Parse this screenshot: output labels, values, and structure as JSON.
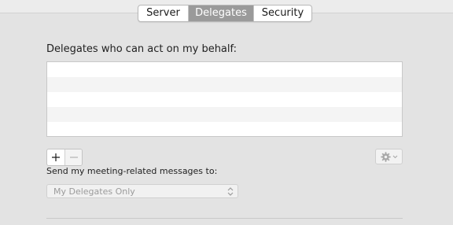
{
  "tabs": [
    {
      "label": "Server",
      "selected": false
    },
    {
      "label": "Delegates",
      "selected": true
    },
    {
      "label": "Security",
      "selected": false
    }
  ],
  "delegates": {
    "label": "Delegates who can act on my behalf:",
    "rows": []
  },
  "list_controls": {
    "add_icon": "plus-icon",
    "remove_icon": "minus-icon",
    "remove_enabled": false,
    "action_icon": "gear-icon",
    "action_menu_icon": "chevron-down-icon",
    "action_enabled": false
  },
  "messages": {
    "label": "Send my meeting-related messages to:",
    "selected": "My Delegates Only",
    "enabled": false,
    "chevron_icon": "up-down-chevron-icon"
  },
  "colors": {
    "selected_tab": "#9a9a9a",
    "panel": "#e3e3e3",
    "disabled_text": "#9b9b9b"
  }
}
